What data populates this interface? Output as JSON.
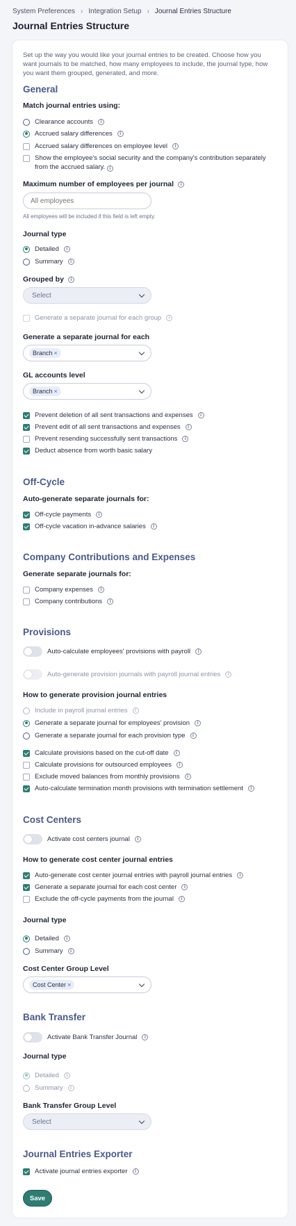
{
  "breadcrumb": [
    "System Preferences",
    "Integration Setup",
    "Journal Entries Structure"
  ],
  "page_title": "Journal Entries Structure",
  "intro": "Set up the way you would like your journal entries to be created. Choose how you want journals to be matched, how many employees to include, the journal type, how you want them grouped, generated, and more.",
  "general": {
    "title": "General",
    "match_label": "Match journal entries using:",
    "match_options": [
      "Clearance accounts",
      "Accrued salary differences"
    ],
    "accrued_employee_level": "Accrued salary differences on employee level",
    "show_social_security": "Show the employee's social security and the company's contribution separately from the accrued salary.",
    "max_employees_label": "Maximum number of employees per journal",
    "max_employees_placeholder": "All employees",
    "max_employees_hint": "All employees will be included if this field is left empty.",
    "journal_type_label": "Journal type",
    "journal_type_options": [
      "Detailed",
      "Summary"
    ],
    "grouped_by_label": "Grouped by",
    "grouped_by_value": "Select",
    "separate_each_group": "Generate a separate journal for each group",
    "separate_journal_label": "Generate a separate journal for each",
    "separate_journal_chip": "Branch",
    "gl_level_label": "GL accounts level",
    "gl_level_chip": "Branch",
    "chip_remove": "×",
    "checks": [
      "Prevent deletion of all sent transactions and expenses",
      "Prevent edit of all sent transactions and expenses",
      "Prevent resending successfully sent transactions",
      "Deduct absence from worth basic salary"
    ]
  },
  "offcycle": {
    "title": "Off-Cycle",
    "label": "Auto-generate separate journals for:",
    "checks": [
      "Off-cycle payments",
      "Off-cycle vacation in-advance salaries"
    ]
  },
  "company": {
    "title": "Company Contributions and Expenses",
    "label": "Generate separate journals for:",
    "checks": [
      "Company expenses",
      "Company contributions"
    ]
  },
  "provisions": {
    "title": "Provisions",
    "toggle_auto_calc": "Auto-calculate employees' provisions with payroll",
    "toggle_auto_gen": "Auto-generate provision journals with payroll journal entries",
    "how_label": "How to generate provision journal entries",
    "radios": [
      "Include in payroll journal entries",
      "Generate a separate journal for employees' provision",
      "Generate a separate journal for each provision type"
    ],
    "checks": [
      "Calculate provisions based on the cut-off date",
      "Calculate provisions for outsourced employees",
      "Exclude moved balances from monthly provisions",
      "Auto-calculate termination month provisions with termination settlement"
    ]
  },
  "cost_centers": {
    "title": "Cost Centers",
    "toggle": "Activate cost centers journal",
    "how_label": "How to generate cost center journal entries",
    "checks": [
      "Auto-generate cost center journal entries with payroll journal entries",
      "Generate a separate journal for each cost center",
      "Exclude the off-cycle payments from the journal"
    ],
    "journal_type_label": "Journal type",
    "journal_type_options": [
      "Detailed",
      "Summary"
    ],
    "group_level_label": "Cost Center Group Level",
    "group_level_chip": "Cost Center"
  },
  "bank": {
    "title": "Bank Transfer",
    "toggle": "Activate Bank Transfer Journal",
    "journal_type_label": "Journal type",
    "journal_type_options": [
      "Detailed",
      "Summary"
    ],
    "group_level_label": "Bank Transfer Group Level",
    "group_level_value": "Select"
  },
  "exporter": {
    "title": "Journal Entries Exporter",
    "check": "Activate journal entries exporter"
  },
  "save_label": "Save",
  "icons": {
    "info": "info-icon",
    "chevron": "chevron-right-icon",
    "dropdown": "chevron-down-icon"
  },
  "colors": {
    "accent": "#2e7d73",
    "section_title": "#4a5a8a"
  }
}
